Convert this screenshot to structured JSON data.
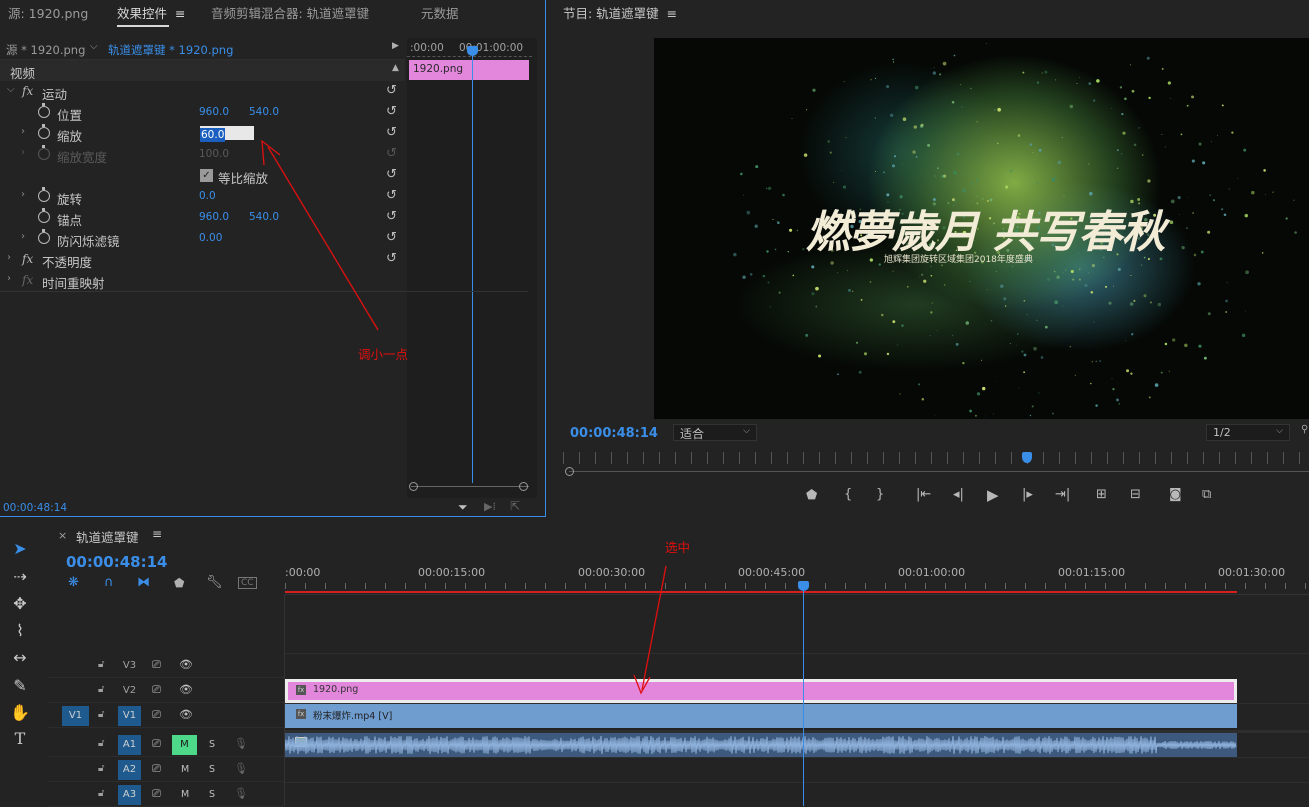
{
  "tabs": {
    "source": "源: 1920.png",
    "effects": "效果控件",
    "mixer": "音频剪辑混合器: 轨道遮罩键",
    "meta": "元数据",
    "program": "节目: 轨道遮罩键"
  },
  "effects": {
    "source_crumb": "源 * 1920.png",
    "seq_crumb": "轨道遮罩键 * 1920.png",
    "video_header": "视频",
    "time_mini": [
      ":00:00",
      "00:01:00:00"
    ],
    "clip_mini": "1920.png",
    "motion": "运动",
    "position": {
      "label": "位置",
      "x": "960.0",
      "y": "540.0"
    },
    "scale": {
      "label": "缩放",
      "value": "60.0"
    },
    "scale_width": {
      "label": "缩放宽度",
      "value": "100.0"
    },
    "uniform": "等比缩放",
    "rotation": {
      "label": "旋转",
      "value": "0.0"
    },
    "anchor": {
      "label": "锚点",
      "x": "960.0",
      "y": "540.0"
    },
    "antiflicker": {
      "label": "防闪烁滤镜",
      "value": "0.00"
    },
    "opacity": "不透明度",
    "time_remap": "时间重映射",
    "current_time": "00:00:48:14"
  },
  "annotations": {
    "scale_note": "调小一点",
    "select_note": "选中"
  },
  "program": {
    "title_main": "燃夢歲月 共写春秋",
    "subtitle": "旭辉集团旋转区域集团2018年度盛典",
    "timecode": "00:00:48:14",
    "fit": "适合",
    "res": "1/2"
  },
  "timeline": {
    "tab_x": "×",
    "title": "轨道遮罩键",
    "timecode": "00:00:48:14",
    "marks": [
      ":00:00",
      "00:00:15:00",
      "00:00:30:00",
      "00:00:45:00",
      "00:01:00:00",
      "00:01:15:00",
      "00:01:30:00"
    ],
    "tracks": [
      {
        "name": "V3",
        "src": ""
      },
      {
        "name": "V2",
        "src": ""
      },
      {
        "name": "V1",
        "src": "V1"
      },
      {
        "name": "A1",
        "src": ""
      },
      {
        "name": "A2",
        "src": ""
      },
      {
        "name": "A3",
        "src": ""
      }
    ],
    "m": "M",
    "s": "S",
    "clip_v2": "1920.png",
    "clip_v1": "粉末爆炸.mp4 [V]"
  },
  "colors": {
    "accent": "#3a8ee8",
    "pink_clip": "#e387dd",
    "blue_clip": "#6f9dd0",
    "annotation": "#e01010"
  }
}
